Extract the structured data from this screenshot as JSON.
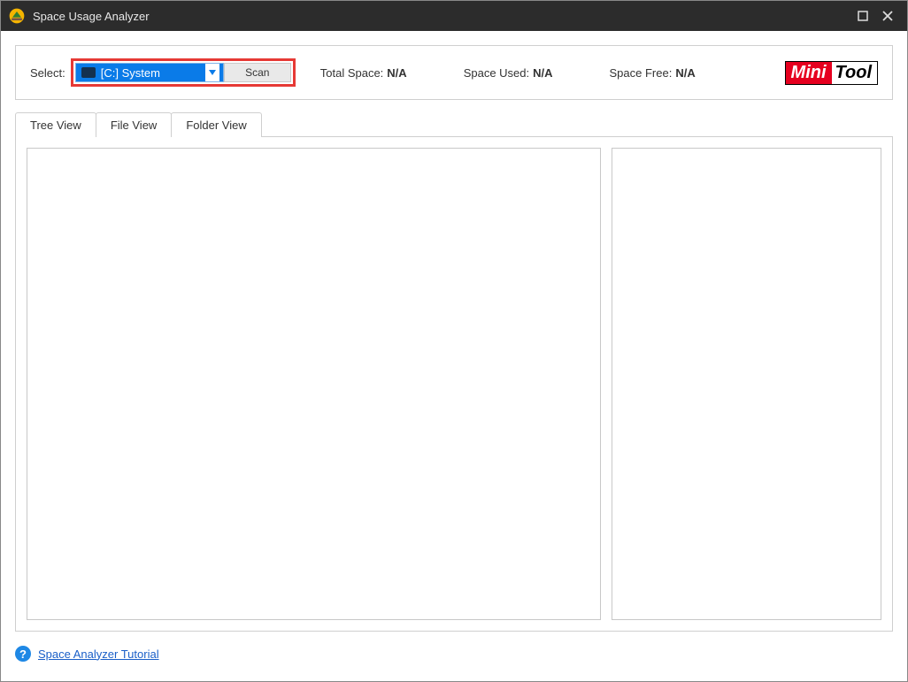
{
  "window": {
    "title": "Space Usage Analyzer"
  },
  "toolbar": {
    "select_label": "Select:",
    "drive_selected": "[C:] System",
    "scan_label": "Scan",
    "total_space_label": "Total Space:",
    "total_space_value": "N/A",
    "space_used_label": "Space Used:",
    "space_used_value": "N/A",
    "space_free_label": "Space Free:",
    "space_free_value": "N/A"
  },
  "logo": {
    "part1": "Mini",
    "part2": "Tool"
  },
  "tabs": {
    "items": [
      {
        "label": "Tree View",
        "active": true
      },
      {
        "label": "File View",
        "active": false
      },
      {
        "label": "Folder View",
        "active": false
      }
    ]
  },
  "footer": {
    "tutorial_link": "Space Analyzer Tutorial"
  }
}
